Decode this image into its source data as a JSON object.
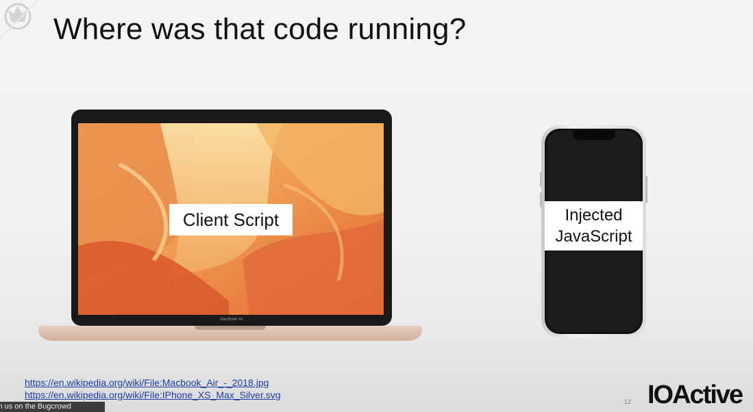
{
  "slide": {
    "title": "Where was that code running?",
    "laptop_brand": "MacBook Air",
    "client_label": "Client Script",
    "phone_label_line1": "Injected",
    "phone_label_line2": "JavaScript",
    "page_number": "12"
  },
  "links": [
    "https://en.wikipedia.org/wiki/File:Macbook_Air_-_2018.jpg",
    "https://en.wikipedia.org/wiki/File:IPhone_XS_Max_Silver.svg"
  ],
  "brand": {
    "name_io": "IO",
    "name_rest": "Active"
  },
  "overlay": {
    "text": "in us on the Bugcrowd"
  },
  "icons": [
    "corner-logo-icon",
    "laptop-image",
    "phone-image"
  ]
}
